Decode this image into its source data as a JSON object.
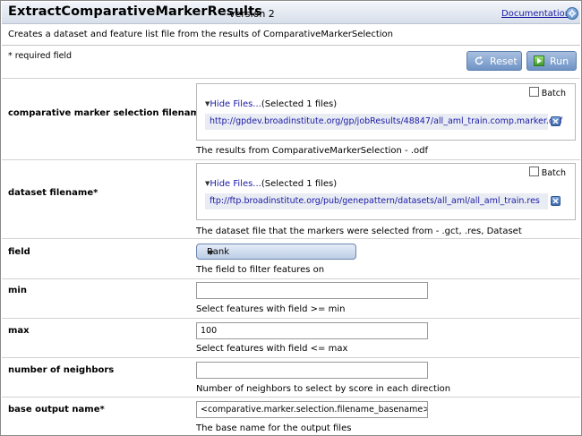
{
  "header": {
    "module_name": "ExtractComparativeMarkerResults",
    "version": "version 2",
    "documentation_label": "Documentation",
    "help_icon": "help-icon"
  },
  "description": "Creates a dataset and feature list file from the results of ComparativeMarkerSelection",
  "required_note": "* required field",
  "buttons": {
    "reset_label": "Reset",
    "run_label": "Run"
  },
  "params": {
    "cms_file": {
      "label": "comparative marker selection filename*",
      "batch_label": "Batch",
      "batch_checked": false,
      "hide_files_label": "Hide Files...",
      "selected_count": "(Selected 1 files)",
      "file_url": "http://gpdev.broadinstitute.org/gp/jobResults/48847/all_aml_train.comp.marker.odf",
      "help": "The results from ComparativeMarkerSelection - .odf"
    },
    "dataset_file": {
      "label": "dataset filename*",
      "batch_label": "Batch",
      "batch_checked": false,
      "hide_files_label": "Hide Files...",
      "selected_count": "(Selected 1 files)",
      "file_url": "ftp://ftp.broadinstitute.org/pub/genepattern/datasets/all_aml/all_aml_train.res",
      "help": "The dataset file that the markers were selected from - .gct, .res, Dataset"
    },
    "field": {
      "label": "field",
      "selected": "Rank",
      "help": "The field to filter features on"
    },
    "min": {
      "label": "min",
      "value": "",
      "help": "Select features with field >= min"
    },
    "max": {
      "label": "max",
      "value": "100",
      "help": "Select features with field <= max"
    },
    "neighbors": {
      "label": "number of neighbors",
      "value": "",
      "help": "Number of neighbors to select by score in each direction"
    },
    "base_output": {
      "label": "base output name*",
      "value": "<comparative.marker.selection.filename_basename>.filt",
      "help": "The base name for the output files"
    }
  },
  "colors": {
    "header_bg": "#dfe6f0",
    "button_blue": "#7a9bcb",
    "link_blue": "#1a1aa6",
    "run_icon_green": "#4caf3a"
  }
}
